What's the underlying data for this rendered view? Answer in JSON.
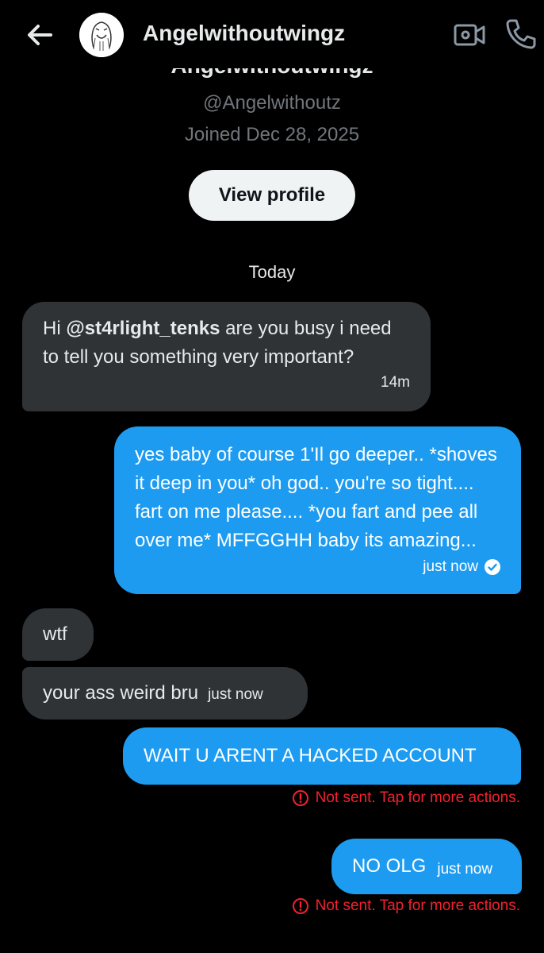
{
  "header": {
    "title": "Angelwithoutwingz",
    "back_icon": "arrow-left-icon",
    "video_icon": "video-call-icon",
    "call_icon": "phone-icon"
  },
  "profile": {
    "display_name": "Angelwithoutwingz",
    "handle": "@Angelwithoutz",
    "joined": "Joined Dec 28, 2025",
    "view_profile_label": "View profile"
  },
  "day_separator": "Today",
  "messages": [
    {
      "direction": "incoming",
      "prefix": "Hi ",
      "mention": "@st4rlight_tenks",
      "text": " are you busy i need to tell you something very important?",
      "time": "14m"
    },
    {
      "direction": "outgoing",
      "text": "yes baby of course 1'Il go deeper.. *shoves it deep in you* oh god.. you're so tight.... fart on me please.... *you fart and pee all over me* MFFGGHH baby its amazing...",
      "time": "just now",
      "status_icon": "check-circle-icon"
    },
    {
      "direction": "incoming",
      "text": "wtf"
    },
    {
      "direction": "incoming",
      "text": "your ass weird bru",
      "time": "just now"
    },
    {
      "direction": "outgoing",
      "text": "WAIT U ARENT A HACKED ACCOUNT",
      "error": "Not sent. Tap for more actions."
    },
    {
      "direction": "outgoing",
      "text": "NO OLG",
      "time": "just now",
      "error": "Not sent. Tap for more actions."
    }
  ],
  "colors": {
    "background": "#000000",
    "incoming_bubble": "#2f3336",
    "outgoing_bubble": "#1d9bf0",
    "error": "#f4212e",
    "muted": "#71767b"
  }
}
